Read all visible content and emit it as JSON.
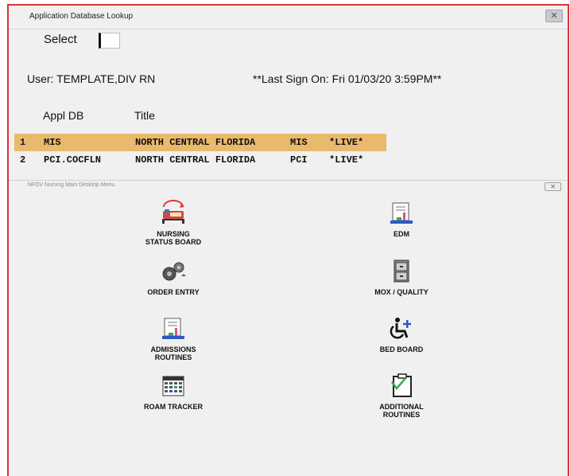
{
  "window1": {
    "title": "Application Database Lookup",
    "close_glyph": "✕",
    "select_label": "Select",
    "select_value": "",
    "user_text": "User: TEMPLATE,DIV RN",
    "last_sign_on": "**Last Sign On: Fri 01/03/20 3:59PM**",
    "columns": {
      "appl_db": "Appl DB",
      "title": "Title"
    },
    "rows": [
      {
        "num": "1",
        "db": "MIS",
        "name": "NORTH CENTRAL FLORIDA",
        "code": "MIS",
        "status": "*LIVE*",
        "selected": true
      },
      {
        "num": "2",
        "db": "PCI.COCFLN",
        "name": "NORTH CENTRAL FLORIDA",
        "code": "PCI",
        "status": "*LIVE*",
        "selected": false
      }
    ],
    "selected_row_color": "#e9b96d"
  },
  "window2": {
    "title": "NFDV Nursing Main Desktop Menu",
    "close_glyph": "✕",
    "menu": [
      {
        "label": "NURSING\nSTATUS BOARD",
        "icon": "nursing-bed-icon"
      },
      {
        "label": "EDM",
        "icon": "chart-clipboard-icon"
      },
      {
        "label": "ORDER ENTRY",
        "icon": "gears-icon"
      },
      {
        "label": "MOX / QUALITY",
        "icon": "file-cabinet-icon"
      },
      {
        "label": "ADMISSIONS\nROUTINES",
        "icon": "chart-clipboard-icon"
      },
      {
        "label": "BED BOARD",
        "icon": "wheelchair-icon"
      },
      {
        "label": "ROAM TRACKER",
        "icon": "calendar-grid-icon"
      },
      {
        "label": "ADDITIONAL\nROUTINES",
        "icon": "checklist-clipboard-icon"
      }
    ]
  }
}
